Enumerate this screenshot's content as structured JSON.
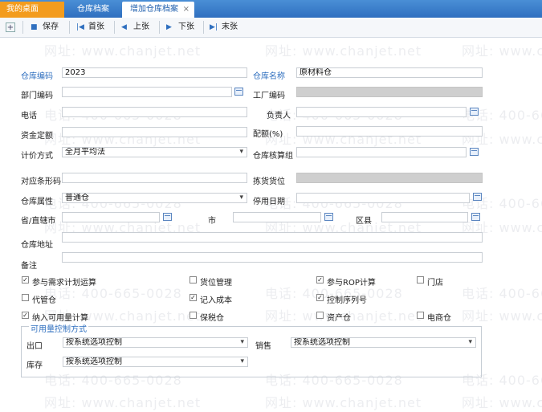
{
  "tabs": {
    "home": "我的桌面",
    "archive": "仓库档案",
    "add": "增加仓库档案",
    "close": "×"
  },
  "toolbar": {
    "plus": "+",
    "save": "保存",
    "first": "首张",
    "prev": "上张",
    "next": "下张",
    "last": "末张"
  },
  "fields": {
    "code_label": "仓库编码",
    "code_value": "2023",
    "name_label": "仓库名称",
    "name_value": "原材料仓",
    "dept_label": "部门编码",
    "factory_label": "工厂编码",
    "phone_label": "电话",
    "manager_label": "负责人",
    "fund_label": "资金定额",
    "ratio_label": "配额(%)",
    "pricing_label": "计价方式",
    "pricing_value": "全月平均法",
    "calc_group_label": "仓库核算组",
    "barcode_label": "对应条形码",
    "picking_label": "拣货货位",
    "attr_label": "仓库属性",
    "attr_value": "普通仓",
    "stop_date_label": "停用日期",
    "province_label": "省/直辖市",
    "city_label": "市",
    "county_label": "区县",
    "address_label": "仓库地址",
    "remark_label": "备注"
  },
  "checks": [
    {
      "label": "参与需求计划运算",
      "checked": true
    },
    {
      "label": "货位管理",
      "checked": false
    },
    {
      "label": "参与ROP计算",
      "checked": true
    },
    {
      "label": "门店",
      "checked": false
    },
    {
      "label": "代管仓",
      "checked": false
    },
    {
      "label": "记入成本",
      "checked": true
    },
    {
      "label": "控制序列号",
      "checked": true
    },
    {
      "label": "纳入可用量计算",
      "checked": true
    },
    {
      "label": "保税仓",
      "checked": false
    },
    {
      "label": "资产仓",
      "checked": false
    },
    {
      "label": "电商仓",
      "checked": false
    }
  ],
  "availability": {
    "title": "可用量控制方式",
    "out_label": "出口",
    "out_value": "按系统选项控制",
    "sale_label": "销售",
    "sale_value": "按系统选项控制",
    "stock_label": "库存",
    "stock_value": "按系统选项控制"
  },
  "watermark": {
    "phone": "电话: 400-665-0028",
    "site": "网址: www.chanjet.net"
  }
}
